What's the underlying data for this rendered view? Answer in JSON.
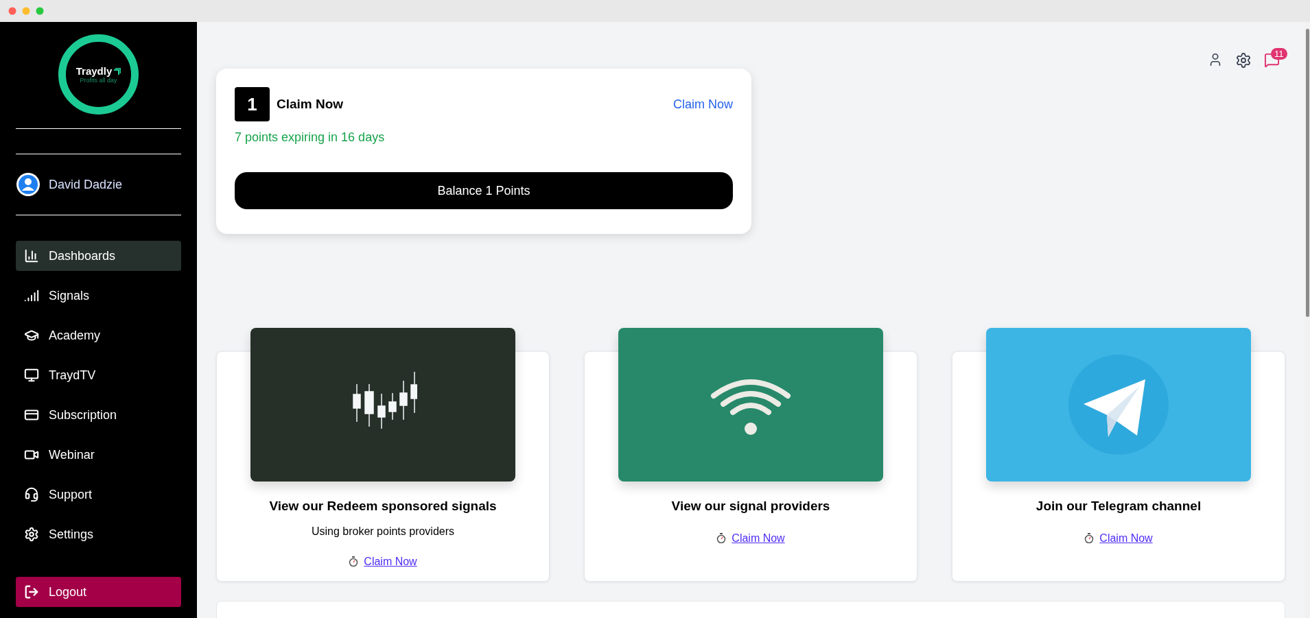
{
  "brand": {
    "name": "Traydly",
    "tagline": "Profits all day"
  },
  "user": {
    "name": "David Dadzie"
  },
  "nav": [
    {
      "label": "Dashboards",
      "selected": true
    },
    {
      "label": "Signals",
      "selected": false
    },
    {
      "label": "Academy",
      "selected": false
    },
    {
      "label": "TraydTV",
      "selected": false
    },
    {
      "label": "Subscription",
      "selected": false
    },
    {
      "label": "Webinar",
      "selected": false
    },
    {
      "label": "Support",
      "selected": false
    },
    {
      "label": "Settings",
      "selected": false
    }
  ],
  "logout": {
    "label": "Logout"
  },
  "header": {
    "notification_count": "11"
  },
  "points_card": {
    "rank": "1",
    "title": "Claim Now",
    "link": "Claim Now",
    "expiry": "7 points expiring in 16 days",
    "balance_button": "Balance 1 Points"
  },
  "offers": [
    {
      "kind": "candles",
      "title": "View our Redeem sponsored signals",
      "subtitle": "Using broker points providers",
      "link": "Claim Now"
    },
    {
      "kind": "wifi",
      "title": "View our signal providers",
      "link": "Claim Now"
    },
    {
      "kind": "telegram",
      "title": "Join our Telegram channel",
      "link": "Claim Now"
    }
  ]
}
